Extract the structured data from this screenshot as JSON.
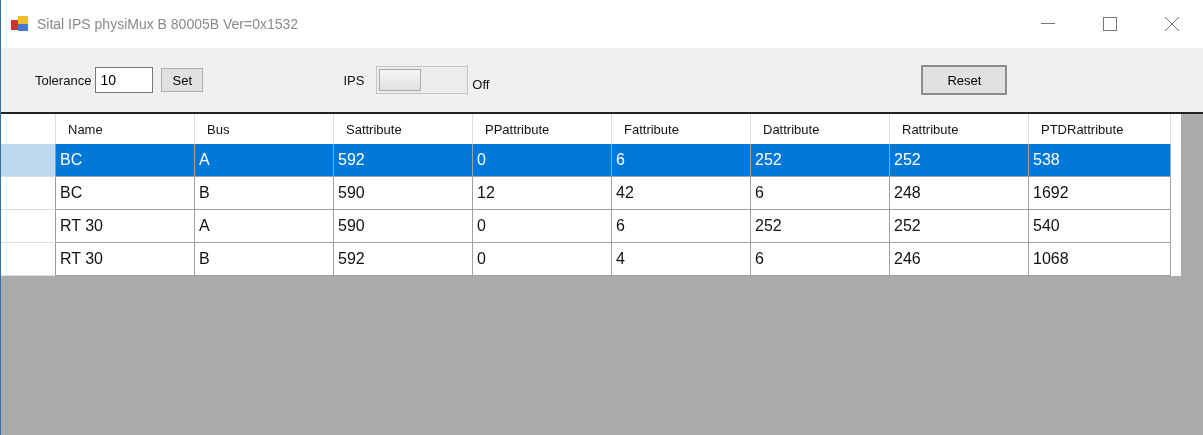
{
  "window": {
    "title": "Sital IPS physiMux B 80005B Ver=0x1532"
  },
  "toolbar": {
    "tolerance_label": "Tolerance",
    "tolerance_value": "10",
    "set_button": "Set",
    "ips_label": "IPS",
    "ips_switch": {
      "on": false
    },
    "ips_state": "Off",
    "reset_button": "Reset"
  },
  "table": {
    "columns": [
      "Name",
      "Bus",
      "Sattribute",
      "PPattribute",
      "Fattribute",
      "Dattribute",
      "Rattribute",
      "PTDRattribute"
    ],
    "rows": [
      {
        "selected": true,
        "cells": [
          "BC",
          "A",
          "592",
          "0",
          "6",
          "252",
          "252",
          "538"
        ]
      },
      {
        "selected": false,
        "cells": [
          "BC",
          "B",
          "590",
          "12",
          "42",
          "6",
          "248",
          "1692"
        ]
      },
      {
        "selected": false,
        "cells": [
          "RT 30",
          "A",
          "590",
          "0",
          "6",
          "252",
          "252",
          "540"
        ]
      },
      {
        "selected": false,
        "cells": [
          "RT 30",
          "B",
          "592",
          "0",
          "4",
          "6",
          "246",
          "1068"
        ]
      }
    ]
  }
}
